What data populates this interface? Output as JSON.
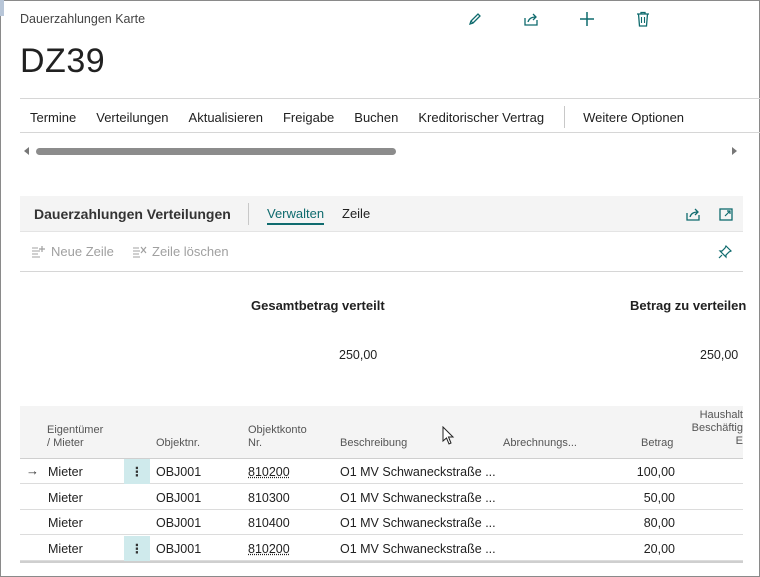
{
  "breadcrumb": "Dauerzahlungen Karte",
  "page_title": "DZ39",
  "top_actions": [
    "edit-icon",
    "share-icon",
    "add-icon",
    "delete-icon"
  ],
  "menu": {
    "items": [
      "Termine",
      "Verteilungen",
      "Aktualisieren",
      "Freigabe",
      "Buchen",
      "Kreditorischer Vertrag"
    ],
    "more": "Weitere Optionen"
  },
  "part": {
    "title": "Dauerzahlungen Verteilungen",
    "tabs": [
      "Verwalten",
      "Zeile"
    ],
    "active_tab": "Verwalten",
    "new_line": "Neue Zeile",
    "delete_line": "Zeile löschen"
  },
  "totals": {
    "distributed_label": "Gesamtbetrag verteilt",
    "distributed_value": "250,00",
    "to_distribute_label": "Betrag zu verteilen",
    "to_distribute_value": "250,00"
  },
  "columns": {
    "owner_1": "Eigentümer",
    "owner_2": "/ Mieter",
    "object_no": "Objektnr.",
    "account_1": "Objektkonto",
    "account_2": "Nr.",
    "description": "Beschreibung",
    "billing": "Abrechnungs...",
    "amount": "Betrag",
    "extra_1": "Haushalt",
    "extra_2": "Beschäftig",
    "extra_3": "E"
  },
  "rows": [
    {
      "owner": "Mieter",
      "object": "OBJ001",
      "account": "810200",
      "description": "O1 MV Schwaneckstraße ...",
      "amount": "100,00"
    },
    {
      "owner": "Mieter",
      "object": "OBJ001",
      "account": "810300",
      "description": "O1 MV Schwaneckstraße ...",
      "amount": "50,00"
    },
    {
      "owner": "Mieter",
      "object": "OBJ001",
      "account": "810400",
      "description": "O1 MV Schwaneckstraße ...",
      "amount": "80,00"
    },
    {
      "owner": "Mieter",
      "object": "OBJ001",
      "account": "810200",
      "description": "O1 MV Schwaneckstraße ...",
      "amount": "20,00"
    }
  ],
  "colors": {
    "accent": "#0f6b6e",
    "row_action_bg": "#cfeaec"
  }
}
